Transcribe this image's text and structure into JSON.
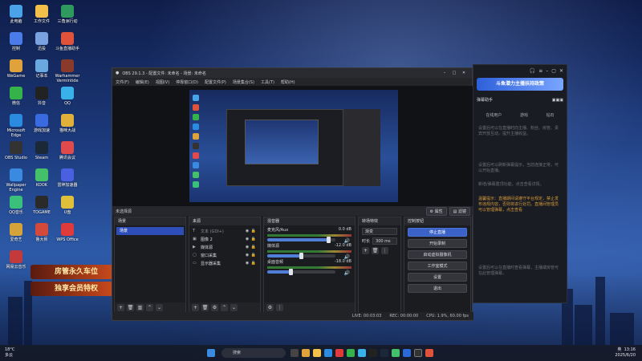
{
  "desktop": {
    "icons": [
      {
        "label": "此电脑",
        "color": "#4aa3e8"
      },
      {
        "label": "工作文件",
        "color": "#f3c04a"
      },
      {
        "label": "三角洲行动",
        "color": "#2f9a5e"
      },
      {
        "label": "控制",
        "color": "#4a7be8"
      },
      {
        "label": "迅投",
        "color": "#7aa1e0"
      },
      {
        "label": "斗鱼直播助手",
        "color": "#e0523a"
      },
      {
        "label": "WeGame",
        "color": "#e0a23a"
      },
      {
        "label": "记事本",
        "color": "#6aa8e0"
      },
      {
        "label": "Warhammer Vermintide",
        "color": "#8a3a2a"
      },
      {
        "label": "微信",
        "color": "#35b34a"
      },
      {
        "label": "抖音",
        "color": "#222222"
      },
      {
        "label": "QQ",
        "color": "#3ab0e8"
      },
      {
        "label": "Microsoft Edge",
        "color": "#2a8be0"
      },
      {
        "label": "游戏加速",
        "color": "#3a6ae0"
      },
      {
        "label": "猫咪大战",
        "color": "#e0b03a"
      },
      {
        "label": "OBS Studio",
        "color": "#333333"
      },
      {
        "label": "Steam",
        "color": "#1b2838"
      },
      {
        "label": "腾讯会议",
        "color": "#e04a4a"
      },
      {
        "label": "Wallpaper Engine",
        "color": "#3a8ae0"
      },
      {
        "label": "KOOK",
        "color": "#45c06a"
      },
      {
        "label": "雷神加速器",
        "color": "#4a60e0"
      },
      {
        "label": "QQ音乐",
        "color": "#3ac07a"
      },
      {
        "label": "TOGAME",
        "color": "#2a2a2a"
      },
      {
        "label": "U盘",
        "color": "#e0c03a"
      },
      {
        "label": "爱奇艺",
        "color": "#d4a33a"
      },
      {
        "label": "鲁大师",
        "color": "#d44a3a"
      },
      {
        "label": "WPS Office",
        "color": "#e03a3a"
      },
      {
        "label": "网易云音乐",
        "color": "#c43a3a"
      }
    ],
    "promo": {
      "line1": "房管永久车位",
      "line2": "独享会员特权"
    }
  },
  "obs": {
    "title": "OBS 29.1.3 - 配置文件: 未命名 - 场景: 未命名",
    "menu": [
      "文件(F)",
      "编辑(E)",
      "视图(V)",
      "停靠窗口(D)",
      "配置文件(P)",
      "场景集合(S)",
      "工具(T)",
      "帮助(H)"
    ],
    "info": {
      "current_scene": "未选择源",
      "properties_btn": "属性",
      "filters_btn": "滤镜"
    },
    "scenes": {
      "title": "场景",
      "items": [
        "场景"
      ]
    },
    "sources": {
      "title": "来源",
      "items": [
        {
          "label": "文本 (GDI+)",
          "icon": "T",
          "dim": true
        },
        {
          "label": "图像 2",
          "icon": "▣",
          "dim": false
        },
        {
          "label": "媒体源",
          "icon": "▶",
          "dim": false
        },
        {
          "label": "窗口采集",
          "icon": "▢",
          "dim": false
        },
        {
          "label": "显示器采集",
          "icon": "▭",
          "dim": false
        }
      ]
    },
    "mixer": {
      "title": "混音器",
      "channels": [
        {
          "name": "麦克风/Aux",
          "db": "0.0 dB",
          "level": 0.9
        },
        {
          "name": "媒体源",
          "db": "-12.0 dB",
          "level": 0.5
        },
        {
          "name": "桌面音频",
          "db": "-18.0 dB",
          "level": 0.35
        }
      ]
    },
    "transitions": {
      "title": "转场特效",
      "type": "渐变",
      "duration_label": "时长",
      "duration": "300 ms"
    },
    "controls": {
      "title": "控制按钮",
      "buttons": [
        "停止直播",
        "开始录制",
        "启动虚拟摄像机",
        "工作室模式",
        "设置",
        "退出"
      ]
    },
    "status": {
      "live": "LIVE: 00:03:03",
      "rec": "REC: 00:00:00",
      "cpu": "CPU: 1.9%, 60.00 fps"
    }
  },
  "assistant": {
    "banner": "斗鱼潜力主播扶持政策",
    "title": "弹幕助手",
    "tabs": [
      "在线用户",
      "游戏",
      "钻石"
    ],
    "intro": "设置后可以在直播时向主播、粉丝、房管、贵宾开放互动，提升主播收益。",
    "notice": "设置后可以刷新弹幕提示，当前连接正常，可以开始直播。",
    "tip": "新增/弹幕置顶功能，点击查看详情。",
    "warn": "温馨提示：直播期间请遵守平台规定，禁止发布违规内容，否则将进行处罚。直播间管理员可以管理弹幕，点击查看",
    "footer": "设置后可以在直播时查看弹幕，主播或房管可在此管理弹幕。"
  },
  "taskbar": {
    "weather_temp": "18°C",
    "weather_desc": "多云",
    "search_placeholder": "搜索",
    "ime": "英",
    "time": "13:16",
    "date": "2025/6/20"
  }
}
